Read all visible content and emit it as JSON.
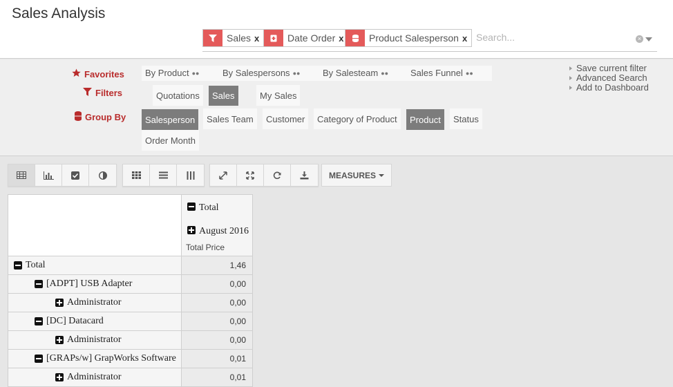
{
  "page": {
    "title": "Sales Analysis"
  },
  "search": {
    "facets": [
      {
        "icon": "filter-icon",
        "label": "Sales"
      },
      {
        "icon": "calendar-icon",
        "label": "Date Order"
      },
      {
        "icon": "stack-icon",
        "label": "Product  Salesperson"
      }
    ],
    "remove_label": "x",
    "placeholder": "Search..."
  },
  "panel": {
    "favorites_label": "Favorites",
    "filters_label": "Filters",
    "groupby_label": "Group By",
    "favorites": [
      "By Product",
      "By Salespersons",
      "By Salesteam",
      "Sales Funnel"
    ],
    "filters": [
      {
        "label": "Quotations",
        "active": false
      },
      {
        "label": "Sales",
        "active": true
      },
      {
        "label": "My Sales",
        "active": false
      }
    ],
    "groupby": [
      {
        "label": "Salesperson",
        "active": true
      },
      {
        "label": "Sales Team",
        "active": false
      },
      {
        "label": "Customer",
        "active": false
      },
      {
        "label": "Category of Product",
        "active": false
      },
      {
        "label": "Product",
        "active": true
      },
      {
        "label": "Status",
        "active": false
      },
      {
        "label": "Order Month",
        "active": false
      }
    ],
    "side_links": [
      "Save current filter",
      "Advanced Search",
      "Add to Dashboard"
    ]
  },
  "toolbar": {
    "view_icons": [
      "table-icon",
      "bar-chart-icon",
      "checkbox-icon",
      "pie-chart-icon"
    ],
    "layout_icons": [
      "grid-icon",
      "list-icon",
      "columns-icon"
    ],
    "action_icons": [
      "expand-icon",
      "collapse-icon",
      "refresh-icon",
      "download-icon"
    ],
    "measures_label": "MEASURES"
  },
  "pivot": {
    "col_header_total": "Total",
    "col_header_period": "August 2016",
    "measure_label": "Total Price",
    "rows": [
      {
        "label": "Total",
        "value": "1,46",
        "level": 0,
        "expanded": true
      },
      {
        "label": "[ADPT] USB Adapter",
        "value": "0,00",
        "level": 1,
        "expanded": true
      },
      {
        "label": "Administrator",
        "value": "0,00",
        "level": 2,
        "expanded": false
      },
      {
        "label": "[DC] Datacard",
        "value": "0,00",
        "level": 1,
        "expanded": true
      },
      {
        "label": "Administrator",
        "value": "0,00",
        "level": 2,
        "expanded": false
      },
      {
        "label": "[GRAPs/w] GrapWorks Software",
        "value": "0,01",
        "level": 1,
        "expanded": true
      },
      {
        "label": "Administrator",
        "value": "0,01",
        "level": 2,
        "expanded": false
      }
    ]
  },
  "colors": {
    "accent": "#b92c2c",
    "facet_icon_bg": "#e45a5a",
    "active_pill": "#7c7c7c"
  }
}
